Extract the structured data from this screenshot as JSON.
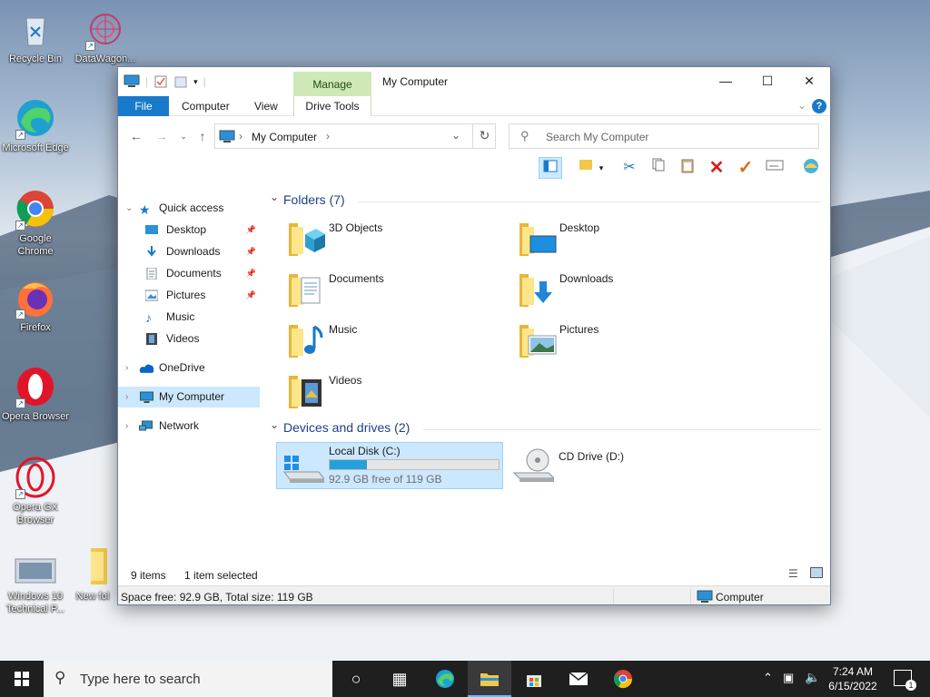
{
  "desktop": {
    "icons": [
      {
        "label": "Recycle Bin",
        "icon": "recycle-bin-icon"
      },
      {
        "label": "DataWagon...",
        "icon": "datawagon-icon"
      },
      {
        "label": "Microsoft Edge",
        "icon": "edge-icon"
      },
      {
        "label": "Google Chrome",
        "icon": "chrome-icon"
      },
      {
        "label": "Firefox",
        "icon": "firefox-icon"
      },
      {
        "label": "Opera Browser",
        "icon": "opera-icon"
      },
      {
        "label": "Opera GX Browser",
        "icon": "opera-gx-icon"
      },
      {
        "label": "Windows 10 Technical P...",
        "icon": "windows-preview-icon"
      },
      {
        "label": "New fol",
        "icon": "folder-icon"
      }
    ]
  },
  "window": {
    "title": "My Computer",
    "manage_tab": "Manage",
    "ribbon_tabs": [
      "File",
      "Computer",
      "View",
      "Drive Tools"
    ],
    "help": "?",
    "address": {
      "path": "My Computer"
    },
    "search": {
      "placeholder": "Search My Computer"
    },
    "nav": {
      "quick_access": "Quick access",
      "items": [
        {
          "label": "Desktop",
          "pinned": true
        },
        {
          "label": "Downloads",
          "pinned": true
        },
        {
          "label": "Documents",
          "pinned": true
        },
        {
          "label": "Pictures",
          "pinned": true
        },
        {
          "label": "Music",
          "pinned": false
        },
        {
          "label": "Videos",
          "pinned": false
        }
      ],
      "onedrive": "OneDrive",
      "my_computer": "My Computer",
      "network": "Network"
    },
    "groups": {
      "folders": "Folders (7)",
      "devices": "Devices and drives (2)"
    },
    "folders": [
      "3D Objects",
      "Desktop",
      "Documents",
      "Downloads",
      "Music",
      "Pictures",
      "Videos"
    ],
    "drives": [
      {
        "name": "Local Disk (C:)",
        "free": "92.9 GB free of 119 GB",
        "used_fraction": 0.219
      },
      {
        "name": "CD Drive (D:)"
      }
    ],
    "status": {
      "items": "9 items",
      "selected": "1 item selected",
      "space": "Space free: 92.9 GB, Total size: 119 GB",
      "location": "Computer"
    }
  },
  "taskbar": {
    "search_placeholder": "Type here to search",
    "time": "7:24 AM",
    "date": "6/15/2022",
    "notifications": "1"
  },
  "colors": {
    "accent": "#1979ca",
    "manage": "#cfe8b7",
    "selection": "#cce8ff",
    "drive_bar": "#26a0da"
  }
}
